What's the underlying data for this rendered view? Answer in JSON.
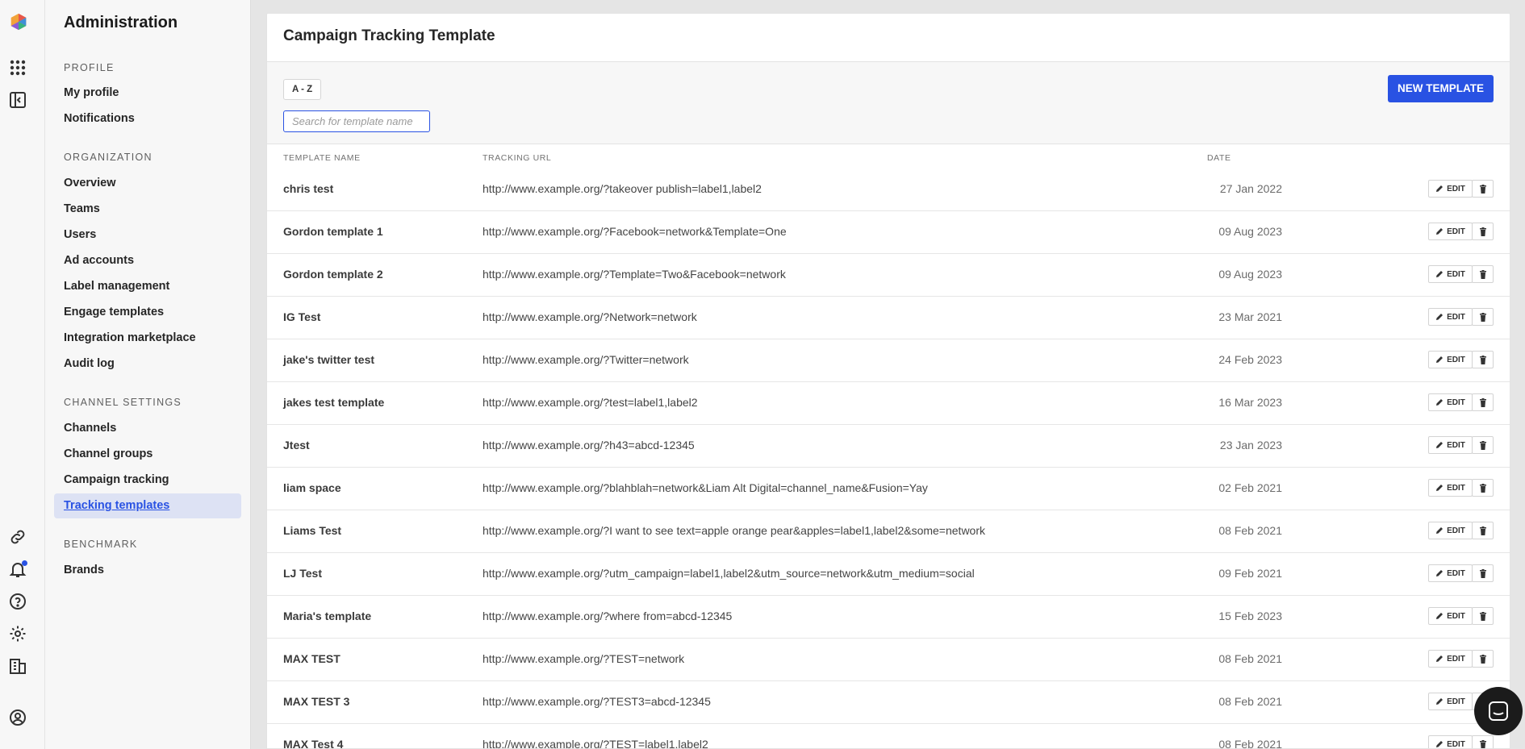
{
  "sidebar": {
    "title": "Administration",
    "sections": [
      {
        "label": "PROFILE",
        "items": [
          "My profile",
          "Notifications"
        ]
      },
      {
        "label": "ORGANIZATION",
        "items": [
          "Overview",
          "Teams",
          "Users",
          "Ad accounts",
          "Label management",
          "Engage templates",
          "Integration marketplace",
          "Audit log"
        ]
      },
      {
        "label": "CHANNEL SETTINGS",
        "items": [
          "Channels",
          "Channel groups",
          "Campaign tracking",
          "Tracking templates"
        ]
      },
      {
        "label": "BENCHMARK",
        "items": [
          "Brands"
        ]
      }
    ],
    "active_item": "Tracking templates"
  },
  "rail_icons": [
    "logo-icon",
    "apps-grid-icon",
    "sidebar-toggle-icon",
    "link-icon",
    "bell-icon",
    "help-icon",
    "gear-icon",
    "building-icon",
    "account-icon"
  ],
  "page": {
    "title": "Campaign Tracking Template",
    "sort_label": "A - Z",
    "search_placeholder": "Search for template name",
    "search_value": "",
    "new_button": "NEW TEMPLATE"
  },
  "table": {
    "columns": [
      "TEMPLATE NAME",
      "TRACKING URL",
      "DATE"
    ],
    "edit_label": "EDIT",
    "rows": [
      {
        "name": "chris test",
        "url": "http://www.example.org/?takeover publish=label1,label2",
        "date": "27 Jan 2022"
      },
      {
        "name": "Gordon template 1",
        "url": "http://www.example.org/?Facebook=network&Template=One",
        "date": "09 Aug 2023"
      },
      {
        "name": "Gordon template 2",
        "url": "http://www.example.org/?Template=Two&Facebook=network",
        "date": "09 Aug 2023"
      },
      {
        "name": "IG Test",
        "url": "http://www.example.org/?Network=network",
        "date": "23 Mar 2021"
      },
      {
        "name": "jake's twitter test",
        "url": "http://www.example.org/?Twitter=network",
        "date": "24 Feb 2023"
      },
      {
        "name": "jakes test template",
        "url": "http://www.example.org/?test=label1,label2",
        "date": "16 Mar 2023"
      },
      {
        "name": "Jtest",
        "url": "http://www.example.org/?h43=abcd-12345",
        "date": "23 Jan 2023"
      },
      {
        "name": "liam space",
        "url": "http://www.example.org/?blahblah=network&Liam Alt Digital=channel_name&Fusion=Yay",
        "date": "02 Feb 2021"
      },
      {
        "name": "Liams Test",
        "url": "http://www.example.org/?I want to see text=apple orange pear&apples=label1,label2&some=network",
        "date": "08 Feb 2021"
      },
      {
        "name": "LJ Test",
        "url": "http://www.example.org/?utm_campaign=label1,label2&utm_source=network&utm_medium=social",
        "date": "09 Feb 2021"
      },
      {
        "name": "Maria's template",
        "url": "http://www.example.org/?where from=abcd-12345",
        "date": "15 Feb 2023"
      },
      {
        "name": "MAX TEST",
        "url": "http://www.example.org/?TEST=network",
        "date": "08 Feb 2021"
      },
      {
        "name": "MAX TEST 3",
        "url": "http://www.example.org/?TEST3=abcd-12345",
        "date": "08 Feb 2021"
      },
      {
        "name": "MAX Test 4",
        "url": "http://www.example.org/?TEST=label1,label2",
        "date": "08 Feb 2021"
      }
    ]
  },
  "colors": {
    "accent": "#2952e3",
    "active_bg": "#dde2f4",
    "notification_dot": "#2952e3"
  }
}
